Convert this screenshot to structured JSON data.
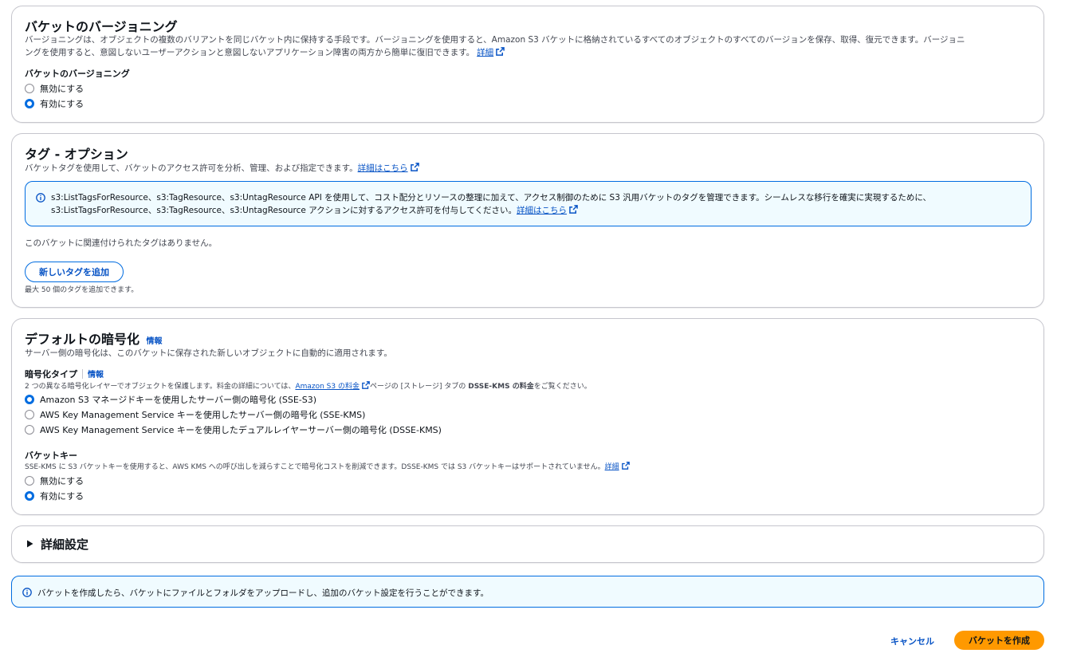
{
  "versioning": {
    "title": "バケットのバージョニング",
    "description_line1": "バージョニングは、オブジェクトの複数のバリアントを同じバケット内に保持する手段です。バージョニングを使用すると、Amazon S3 バケットに格納されているすべてのオブジェクトのすべてのバージョンを保存、取得、復元できます。バージョニ",
    "description_line2": "ングを使用すると、意図しないユーザーアクションと意図しないアプリケーション障害の両方から簡単に復旧できます。",
    "learn_more": "詳細",
    "field_label": "バケットのバージョニング",
    "options": [
      "無効にする",
      "有効にする"
    ],
    "selected": "有効にする"
  },
  "tags": {
    "title": "タグ - オプション",
    "description": "バケットタグを使用して、バケットのアクセス許可を分析、管理、および指定できます。",
    "learn_more": "詳細はこちら",
    "alert_line1": "s3:ListTagsForResource、s3:TagResource、s3:UntagResource API を使用して、コスト配分とリソースの整理に加えて、アクセス制御のために S3 汎用バケットのタグを管理できます。シームレスな移行を確実に実現するために、",
    "alert_line2": "s3:ListTagsForResource、s3:TagResource、s3:UntagResource アクションに対するアクセス許可を付与してください。",
    "alert_link": "詳細はこちら",
    "empty_text": "このバケットに関連付けられたタグはありません。",
    "add_button": "新しいタグを追加",
    "limit_text": "最大 50 個のタグを追加できます。"
  },
  "encryption": {
    "title": "デフォルトの暗号化",
    "info": "情報",
    "description": "サーバー側の暗号化は、このバケットに保存された新しいオブジェクトに自動的に適用されます。",
    "type_label": "暗号化タイプ",
    "type_info": "情報",
    "type_desc_prefix": "2 つの異なる暗号化レイヤーでオブジェクトを保護します。料金の詳細については、",
    "type_desc_link": "Amazon S3 の料金",
    "type_desc_suffix": "ページの [ストレージ] タブの ",
    "type_desc_bold": "DSSE-KMS の料金",
    "type_desc_end": "をご覧ください。",
    "type_options": [
      "Amazon S3 マネージドキーを使用したサーバー側の暗号化 (SSE-S3)",
      "AWS Key Management Service キーを使用したサーバー側の暗号化 (SSE-KMS)",
      "AWS Key Management Service キーを使用したデュアルレイヤーサーバー側の暗号化 (DSSE-KMS)"
    ],
    "type_selected": "Amazon S3 マネージドキーを使用したサーバー側の暗号化 (SSE-S3)",
    "bucket_key_label": "バケットキー",
    "bucket_key_desc": "SSE-KMS に S3 バケットキーを使用すると、AWS KMS への呼び出しを減らすことで暗号化コストを削減できます。DSSE-KMS では S3 バケットキーはサポートされていません。",
    "bucket_key_link": "詳細",
    "bucket_key_options": [
      "無効にする",
      "有効にする"
    ],
    "bucket_key_selected": "有効にする"
  },
  "advanced": {
    "title": "詳細設定"
  },
  "footer_alert": {
    "text": "バケットを作成したら、バケットにファイルとフォルダをアップロードし、追加のバケット設定を行うことができます。"
  },
  "actions": {
    "cancel": "キャンセル",
    "create": "バケットを作成"
  },
  "colors": {
    "link": "#0753c5",
    "primary_button": "#ff9900",
    "radio_selected": "#006ce0",
    "info_alert_bg": "#f0fbff",
    "info_alert_border": "#006ce0"
  }
}
